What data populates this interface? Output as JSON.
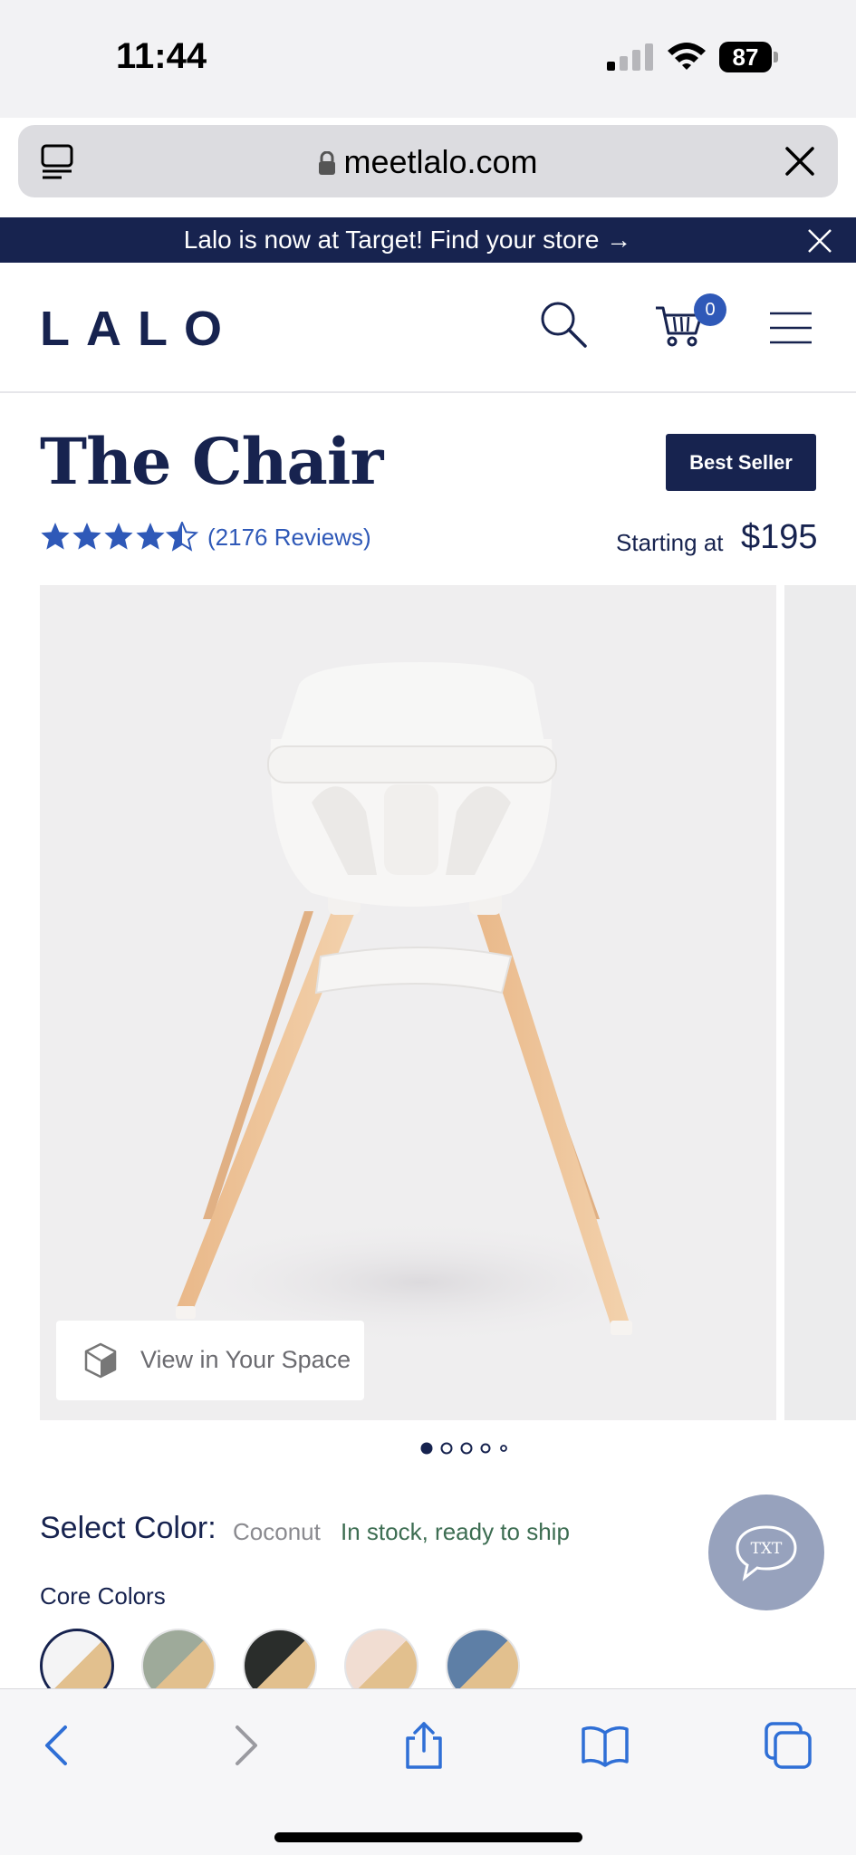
{
  "status_bar": {
    "time": "11:44",
    "battery": "87"
  },
  "browser": {
    "url": "meetlalo.com"
  },
  "promo": {
    "text": "Lalo is now at Target! Find your store →"
  },
  "header": {
    "logo": "LALO",
    "cart_count": "0"
  },
  "product": {
    "title": "The Chair",
    "badge": "Best Seller",
    "rating": 4.5,
    "reviews": "(2176 Reviews)",
    "starting_label": "Starting at",
    "price": "$195"
  },
  "gallery": {
    "view_in_space": "View in Your Space",
    "image_count": 5,
    "active_index": 0
  },
  "color": {
    "label": "Select Color:",
    "selected": "Coconut",
    "stock": "In stock, ready to ship",
    "group_label": "Core Colors",
    "swatches": [
      {
        "name": "coconut",
        "color": "#f4f4f5"
      },
      {
        "name": "sage",
        "color": "#9eaa9a"
      },
      {
        "name": "licorice",
        "color": "#2a2d2b"
      },
      {
        "name": "grapefruit",
        "color": "#f1ddd2"
      },
      {
        "name": "blueberry",
        "color": "#5e7fa6"
      }
    ],
    "wood_color": "#e2c08e"
  },
  "chat": {
    "label": "TXT"
  },
  "colors": {
    "navy": "#17234f",
    "accent_blue": "#2f59b8",
    "stock_green": "#3d6d52"
  }
}
